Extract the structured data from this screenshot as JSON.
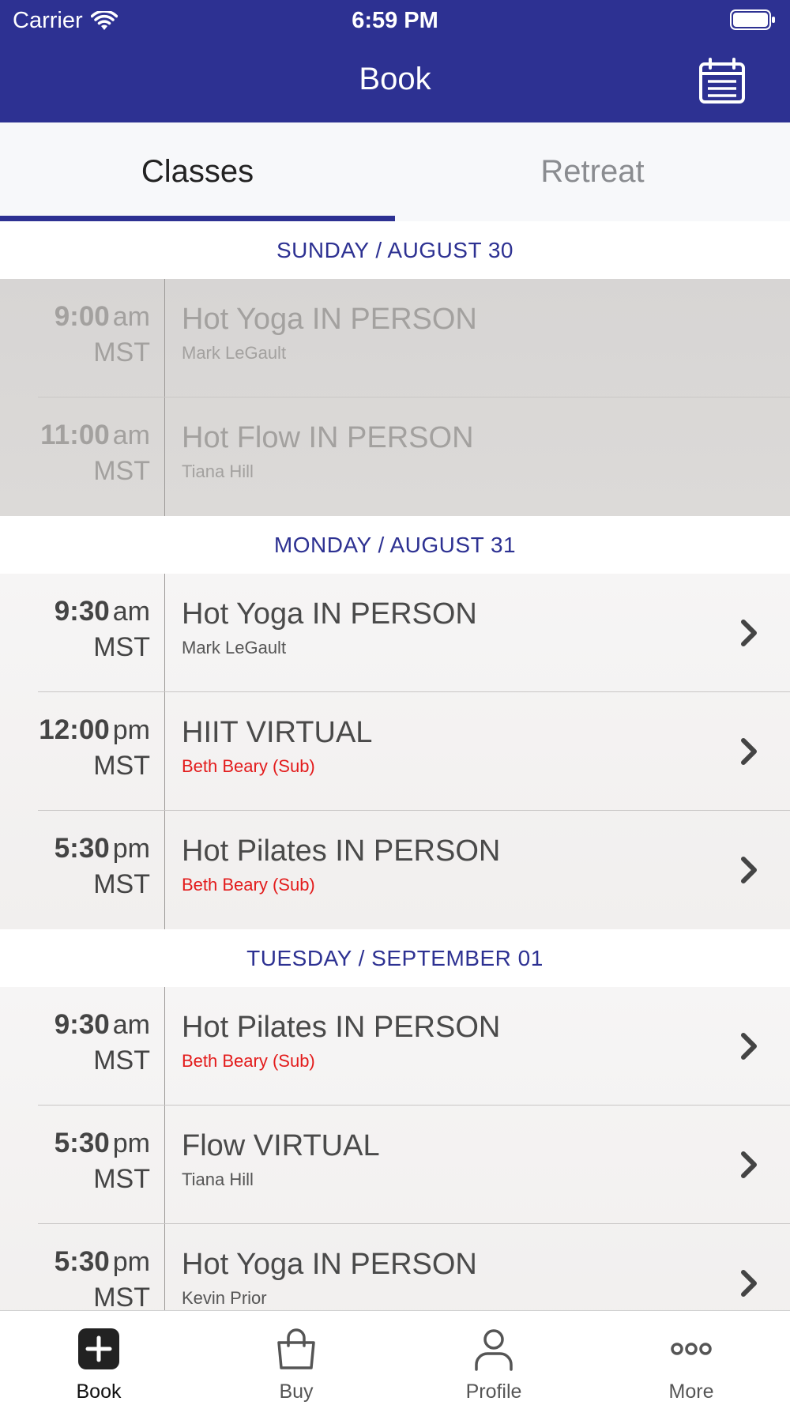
{
  "status_bar": {
    "carrier": "Carrier",
    "time": "6:59 PM"
  },
  "nav": {
    "title": "Book"
  },
  "tabs": [
    {
      "label": "Classes",
      "active": true
    },
    {
      "label": "Retreat",
      "active": false
    }
  ],
  "days": [
    {
      "header": "SUNDAY / AUGUST 30",
      "past": true,
      "classes": [
        {
          "time": "9:00",
          "ampm": "am",
          "tz": "MST",
          "name": "Hot Yoga IN PERSON",
          "instructor": "Mark LeGault",
          "sub": false
        },
        {
          "time": "11:00",
          "ampm": "am",
          "tz": "MST",
          "name": "Hot Flow IN PERSON",
          "instructor": "Tiana Hill",
          "sub": false
        }
      ]
    },
    {
      "header": "MONDAY / AUGUST 31",
      "past": false,
      "classes": [
        {
          "time": "9:30",
          "ampm": "am",
          "tz": "MST",
          "name": "Hot Yoga IN PERSON",
          "instructor": "Mark LeGault",
          "sub": false
        },
        {
          "time": "12:00",
          "ampm": "pm",
          "tz": "MST",
          "name": "HIIT VIRTUAL",
          "instructor": "Beth Beary (Sub)",
          "sub": true
        },
        {
          "time": "5:30",
          "ampm": "pm",
          "tz": "MST",
          "name": "Hot Pilates IN PERSON",
          "instructor": "Beth Beary (Sub)",
          "sub": true
        }
      ]
    },
    {
      "header": "TUESDAY / SEPTEMBER 01",
      "past": false,
      "classes": [
        {
          "time": "9:30",
          "ampm": "am",
          "tz": "MST",
          "name": "Hot Pilates IN PERSON",
          "instructor": "Beth Beary (Sub)",
          "sub": true
        },
        {
          "time": "5:30",
          "ampm": "pm",
          "tz": "MST",
          "name": "Flow VIRTUAL",
          "instructor": "Tiana Hill",
          "sub": false
        },
        {
          "time": "5:30",
          "ampm": "pm",
          "tz": "MST",
          "name": "Hot Yoga IN PERSON",
          "instructor": "Kevin Prior",
          "sub": false
        }
      ]
    }
  ],
  "bottom_nav": [
    {
      "label": "Book",
      "icon": "plus-square-icon",
      "active": true
    },
    {
      "label": "Buy",
      "icon": "shopping-bag-icon",
      "active": false
    },
    {
      "label": "Profile",
      "icon": "person-icon",
      "active": false
    },
    {
      "label": "More",
      "icon": "ellipsis-icon",
      "active": false
    }
  ],
  "colors": {
    "brand": "#2d3192",
    "sub_instructor": "#e31b1b"
  }
}
